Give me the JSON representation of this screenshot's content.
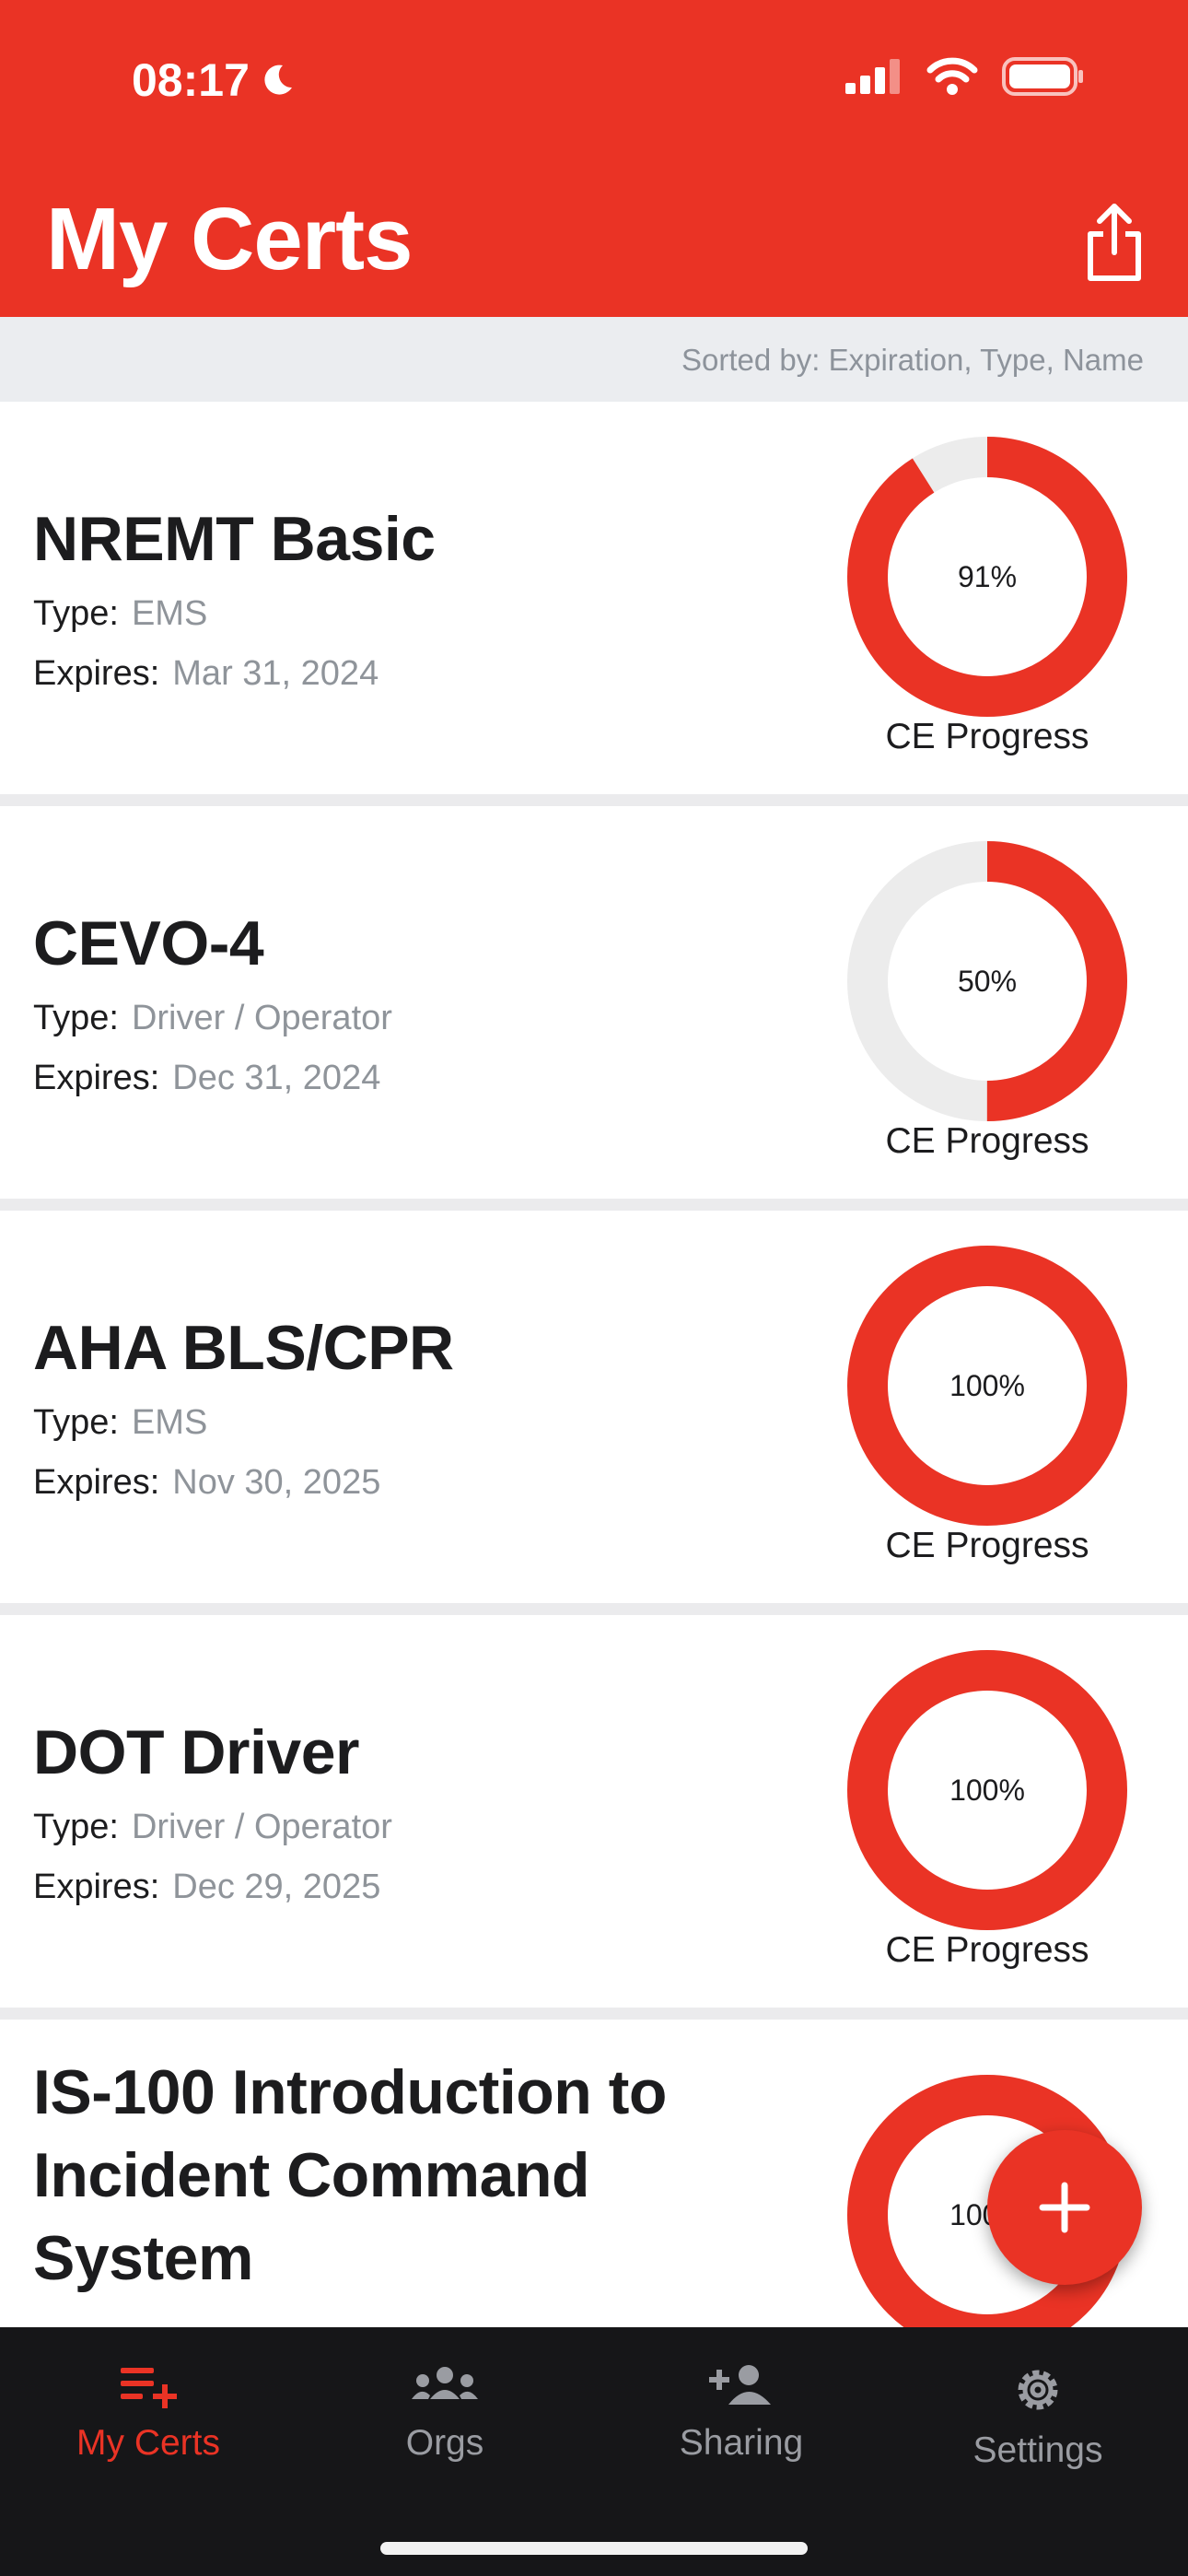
{
  "status": {
    "time": "08:17"
  },
  "header": {
    "title": "My Certs"
  },
  "sort": {
    "text": "Sorted by: Expiration, Type, Name"
  },
  "labels": {
    "type": "Type:",
    "expires": "Expires:",
    "ce": "CE Progress"
  },
  "certs": [
    {
      "name": "NREMT Basic",
      "type": "EMS",
      "expires": "Mar 31, 2024",
      "progress_label": "91%",
      "progress": 0.91
    },
    {
      "name": "CEVO-4",
      "type": "Driver / Operator",
      "expires": "Dec 31, 2024",
      "progress_label": "50%",
      "progress": 0.5
    },
    {
      "name": "AHA BLS/CPR",
      "type": "EMS",
      "expires": "Nov 30, 2025",
      "progress_label": "100%",
      "progress": 1.0
    },
    {
      "name": "DOT Driver",
      "type": "Driver / Operator",
      "expires": "Dec 29, 2025",
      "progress_label": "100%",
      "progress": 1.0
    },
    {
      "name_lines": [
        "IS-100 Introduction to",
        "Incident Command",
        "System"
      ],
      "progress_label": "100%",
      "progress": 1.0
    }
  ],
  "tabs": [
    {
      "label": "My Certs",
      "icon": "list-add-icon",
      "active": true
    },
    {
      "label": "Orgs",
      "icon": "people-icon",
      "active": false
    },
    {
      "label": "Sharing",
      "icon": "person-add-icon",
      "active": false
    },
    {
      "label": "Settings",
      "icon": "gear-icon",
      "active": false
    }
  ],
  "colors": {
    "accent": "#ea3325",
    "track": "#ececec",
    "tabbar": "#161618"
  }
}
